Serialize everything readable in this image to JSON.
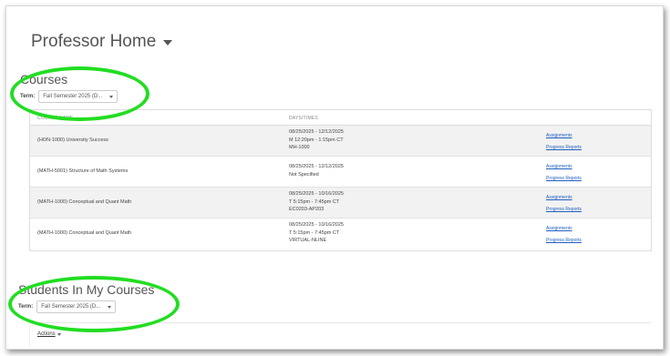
{
  "page": {
    "title": "Professor Home"
  },
  "courses": {
    "title": "Courses",
    "term_label": "Term:",
    "term_value": "Fall Semester 2025 (D...",
    "columns": [
      "COURSE NAME",
      "DAYS/TIMES"
    ],
    "rows": [
      {
        "name": "(HON-1000) University Success",
        "days": [
          "08/25/2025 - 12/12/2025",
          "M 12:20pm - 1:15pm CT",
          "MH-1000"
        ],
        "links": [
          "Assignments",
          "Progress Reports"
        ]
      },
      {
        "name": "(MATH-5001) Structure of Math Systems",
        "days": [
          "08/25/2025 - 12/12/2025",
          "Not Specified"
        ],
        "links": [
          "Assignments",
          "Progress Reports"
        ]
      },
      {
        "name": "(MATH-1000) Conceptual and Quant Math",
        "days": [
          "08/25/2025 - 10/16/2025",
          "T 5:15pm - 7:45pm CT",
          "EC0203-AP203"
        ],
        "links": [
          "Assignments",
          "Progress Reports"
        ]
      },
      {
        "name": "(MATH-1000) Conceptual and Quant Math",
        "days": [
          "08/25/2025 - 10/16/2025",
          "T 5:15pm - 7:45pm CT",
          "VIRTUAL-NLINE"
        ],
        "links": [
          "Assignments",
          "Progress Reports"
        ]
      }
    ]
  },
  "students": {
    "title": "Students In My Courses",
    "term_label": "Term:",
    "term_value": "Fall Semester 2025 (D...",
    "actions_label": "Actions"
  },
  "colors": {
    "highlight": "#22dd22",
    "link": "#1f5fbf"
  }
}
